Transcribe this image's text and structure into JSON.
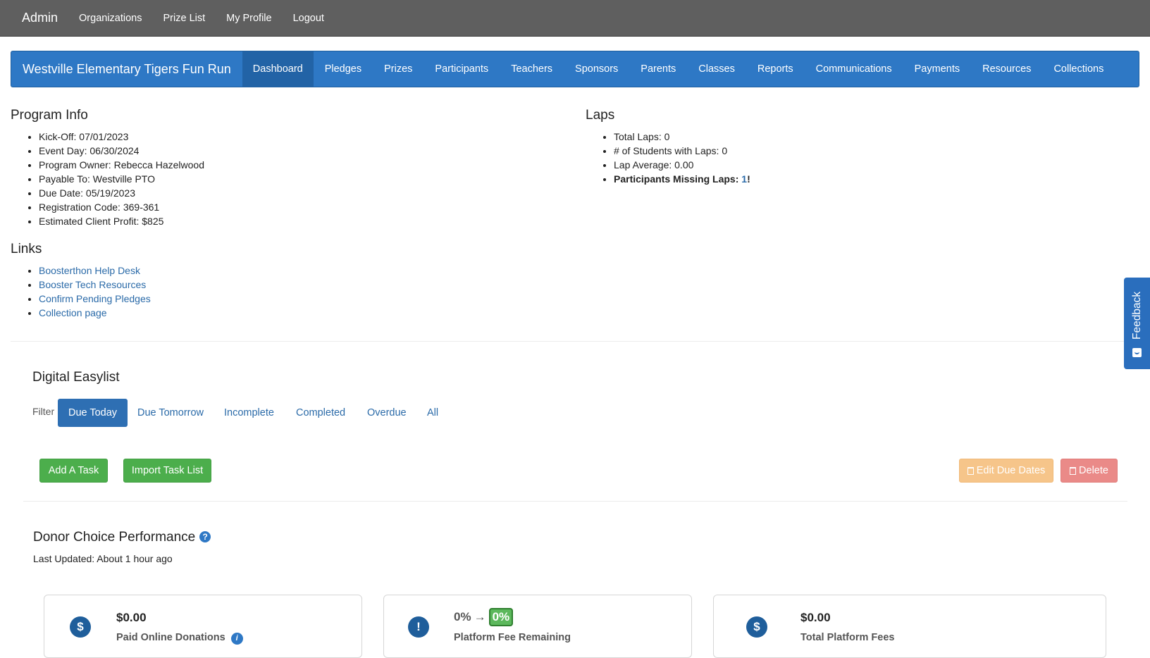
{
  "admin_bar": {
    "brand": "Admin",
    "links": [
      "Organizations",
      "Prize List",
      "My Profile",
      "Logout"
    ]
  },
  "program_nav": {
    "brand": "Westville Elementary Tigers Fun Run",
    "items": [
      "Dashboard",
      "Pledges",
      "Prizes",
      "Participants",
      "Teachers",
      "Sponsors",
      "Parents",
      "Classes",
      "Reports",
      "Communications",
      "Payments",
      "Resources",
      "Collections"
    ],
    "active": "Dashboard"
  },
  "program_info": {
    "title": "Program Info",
    "items": [
      "Kick-Off: 07/01/2023",
      "Event Day: 06/30/2024",
      "Program Owner: Rebecca Hazelwood",
      "Payable To: Westville PTO",
      "Due Date: 05/19/2023",
      "Registration Code: 369-361",
      "Estimated Client Profit: $825"
    ]
  },
  "laps": {
    "title": "Laps",
    "items": [
      "Total Laps: 0",
      "# of Students with Laps: 0",
      "Lap Average: 0.00"
    ],
    "missing_label": "Participants Missing Laps: ",
    "missing_count": "1",
    "missing_suffix": "!"
  },
  "links": {
    "title": "Links",
    "items": [
      "Boosterthon Help Desk",
      "Booster Tech Resources",
      "Confirm Pending Pledges",
      "Collection page"
    ]
  },
  "feedback": {
    "label": "Feedback"
  },
  "easylist": {
    "title": "Digital Easylist",
    "filter_label": "Filter",
    "filters": [
      "Due Today",
      "Due Tomorrow",
      "Incomplete",
      "Completed",
      "Overdue",
      "All"
    ],
    "active_filter": "Due Today",
    "add_task": "Add A Task",
    "import_task": "Import Task List",
    "edit_due_dates": "Edit Due Dates",
    "delete": "Delete"
  },
  "donor_choice": {
    "title": "Donor Choice Performance",
    "last_updated": "Last Updated: About 1 hour ago",
    "cards": [
      {
        "icon": "dollar-icon",
        "value": "$0.00",
        "label": "Paid Online Donations"
      },
      {
        "icon": "exclamation-icon",
        "fee_old": "0%",
        "arrow": "→",
        "fee_new": "0%",
        "label": "Platform Fee Remaining"
      },
      {
        "icon": "dollar-icon",
        "value": "$0.00",
        "label": "Total Platform Fees"
      }
    ]
  },
  "colors": {
    "admin_bar": "#5f5f5f",
    "nav": "#2e78c5",
    "nav_active": "#2263a6",
    "link": "#2a6aa8",
    "success": "#4cae4c",
    "warning": "#f6c58a",
    "danger": "#ea8a88",
    "missing": "#a93232"
  }
}
